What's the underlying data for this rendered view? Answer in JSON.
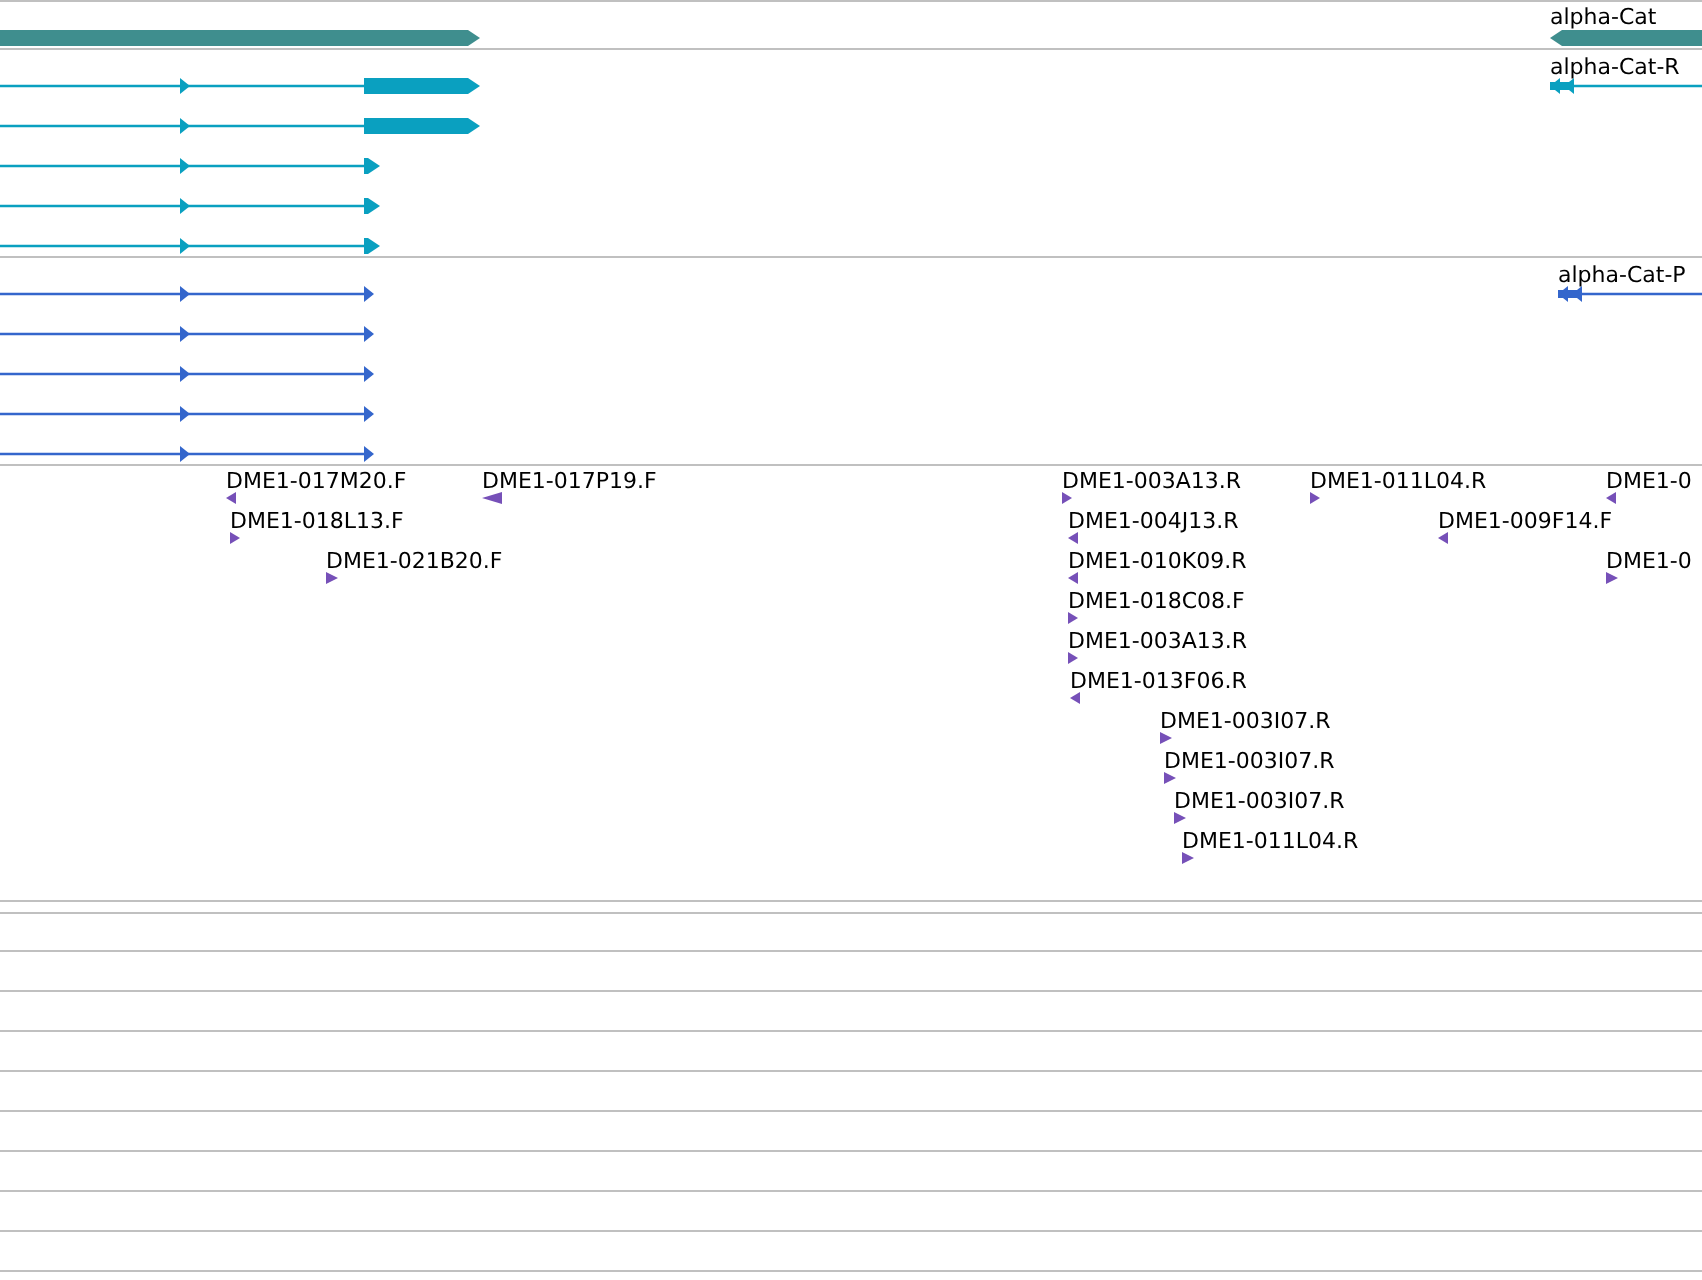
{
  "tracks": [
    {
      "kind": "gene",
      "features": [
        {
          "reverse": false
        },
        {
          "label": "alpha-Cat",
          "reverse": true
        }
      ]
    },
    {
      "kind": "transcript",
      "features": [
        {
          "reverse": false
        },
        {
          "reverse": false
        },
        {
          "reverse": false
        },
        {
          "reverse": false
        },
        {
          "reverse": false
        },
        {
          "label": "alpha-Cat-R",
          "reverse": true
        }
      ]
    },
    {
      "kind": "protein",
      "features": [
        {
          "reverse": false
        },
        {
          "reverse": false
        },
        {
          "reverse": false
        },
        {
          "reverse": false
        },
        {
          "reverse": false
        },
        {
          "label": "alpha-Cat-P",
          "reverse": true
        }
      ]
    },
    {
      "kind": "est",
      "features": [
        {
          "label": "DME1-017M20.F",
          "reverse": true
        },
        {
          "label": "DME1-018L13.F",
          "reverse": false
        },
        {
          "label": "DME1-021B20.F",
          "reverse": false
        },
        {
          "label": "DME1-017P19.F",
          "reverse": true
        },
        {
          "label": "DME1-003A13.R",
          "reverse": false
        },
        {
          "label": "DME1-004J13.R",
          "reverse": true
        },
        {
          "label": "DME1-010K09.R",
          "reverse": true
        },
        {
          "label": "DME1-018C08.F",
          "reverse": false
        },
        {
          "label": "DME1-003A13.R",
          "reverse": false
        },
        {
          "label": "DME1-013F06.R",
          "reverse": true
        },
        {
          "label": "DME1-003I07.R",
          "reverse": false
        },
        {
          "label": "DME1-003I07.R",
          "reverse": false
        },
        {
          "label": "DME1-003I07.R",
          "reverse": false
        },
        {
          "label": "DME1-011L04.R",
          "reverse": false
        },
        {
          "label": "DME1-011L04.R",
          "reverse": false
        },
        {
          "label": "DME1-009F14.F",
          "reverse": true
        },
        {
          "label": "DME1-0",
          "reverse": true
        },
        {
          "label": "DME1-0",
          "reverse": false
        }
      ]
    }
  ]
}
